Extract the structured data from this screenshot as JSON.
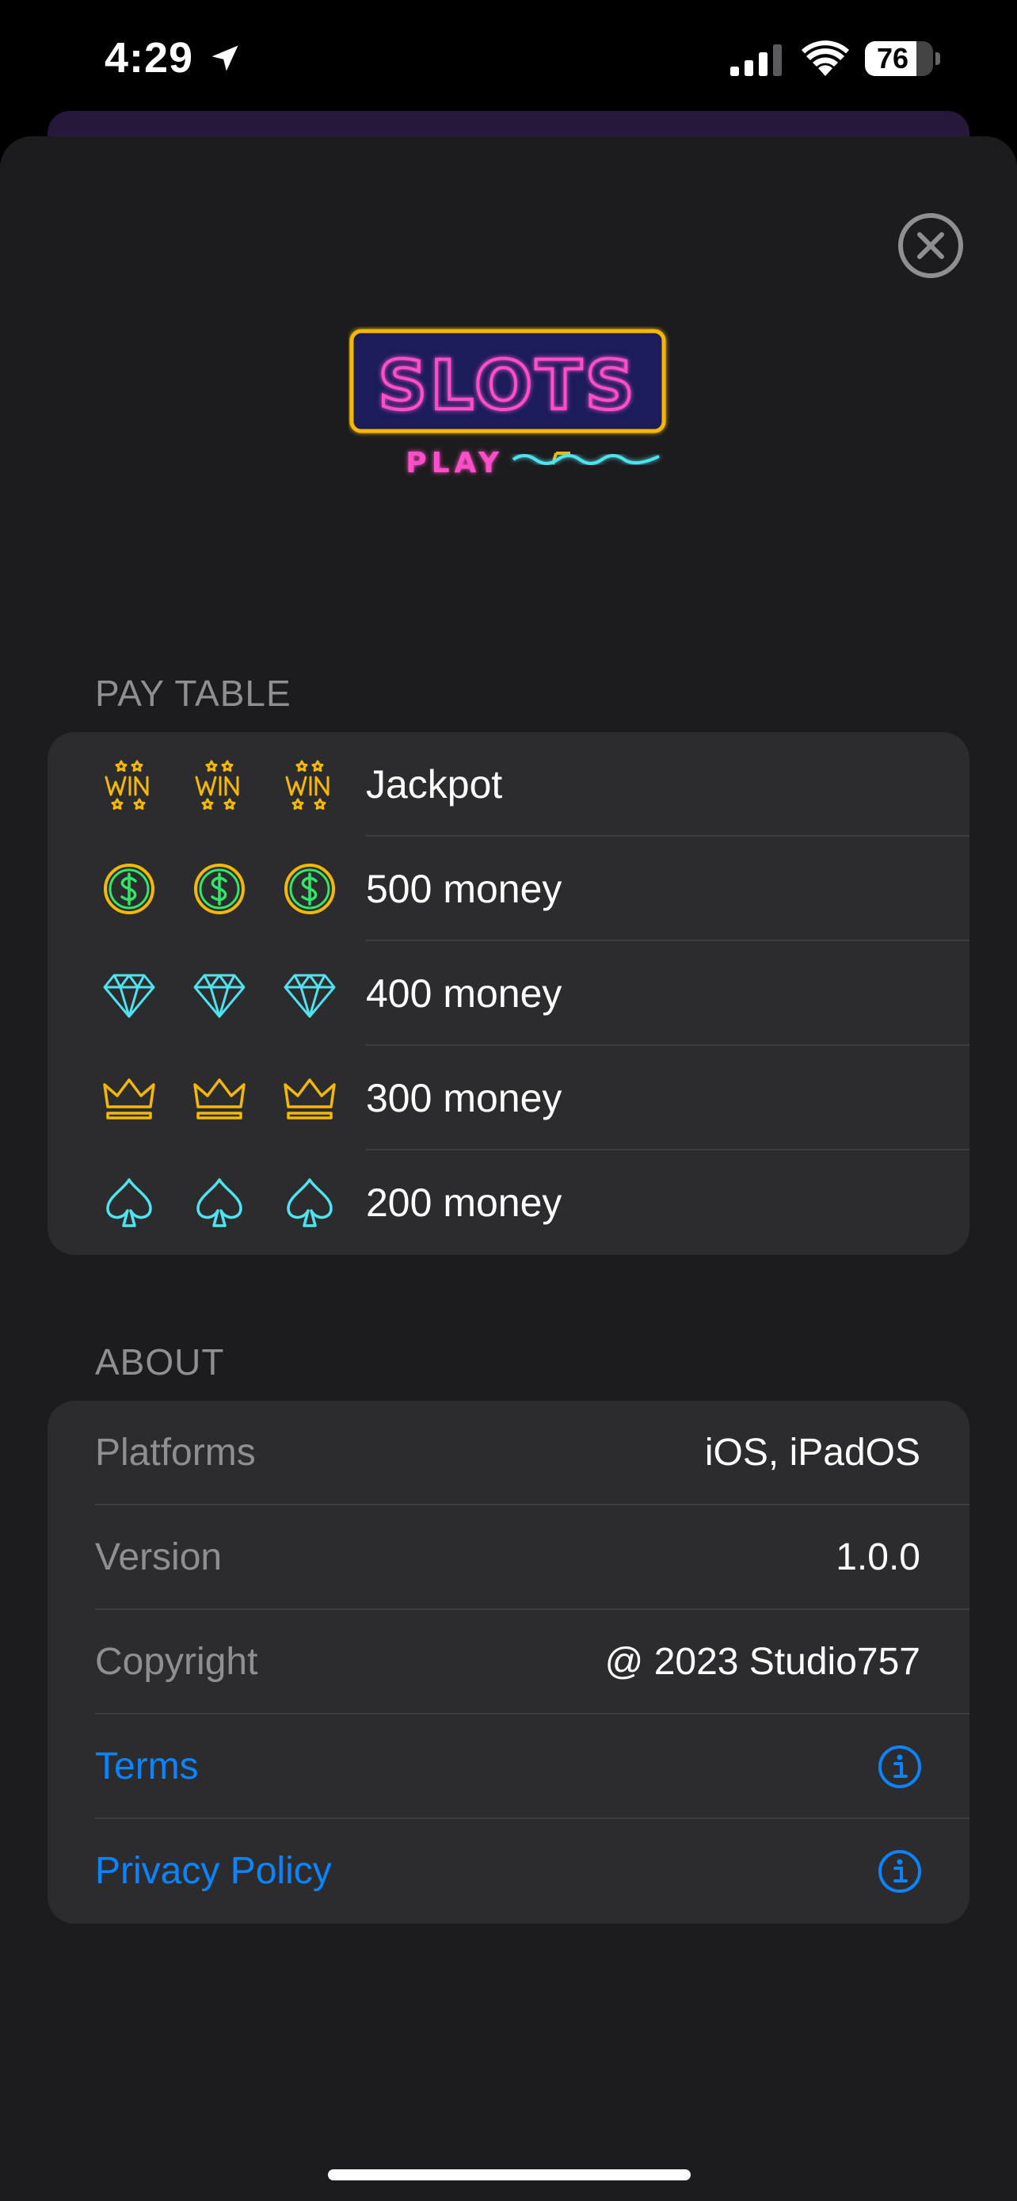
{
  "status_bar": {
    "time": "4:29",
    "battery_level": "76",
    "battery_percent": 76,
    "icons": [
      "location-arrow-icon",
      "cellular-signal-icon",
      "wifi-icon",
      "battery-icon"
    ]
  },
  "logo": {
    "title": "SLOTS",
    "subtitle": "PLAY"
  },
  "pay_table": {
    "header": "PAY TABLE",
    "rows": [
      {
        "symbol": "win-icon",
        "label": "Jackpot"
      },
      {
        "symbol": "dollar-coin-icon",
        "label": "500 money"
      },
      {
        "symbol": "diamond-icon",
        "label": "400 money"
      },
      {
        "symbol": "crown-icon",
        "label": "300 money"
      },
      {
        "symbol": "spade-icon",
        "label": "200 money"
      }
    ]
  },
  "about": {
    "header": "ABOUT",
    "rows": [
      {
        "key": "Platforms",
        "value": "iOS, iPadOS"
      },
      {
        "key": "Version",
        "value": "1.0.0"
      },
      {
        "key": "Copyright",
        "value": "@ 2023 Studio757"
      }
    ],
    "links": [
      {
        "label": "Terms",
        "icon": "info-icon"
      },
      {
        "label": "Privacy Policy",
        "icon": "info-icon"
      }
    ]
  },
  "colors": {
    "sheet_background": "#1c1c1e",
    "card_background": "#2c2c2e",
    "secondary_text": "#8e8e93",
    "link": "#0a84ff",
    "neon_gold": "#f5b800",
    "neon_cyan": "#4fe3f0",
    "neon_green": "#2ee86a",
    "neon_pink": "#ff4fc8"
  }
}
